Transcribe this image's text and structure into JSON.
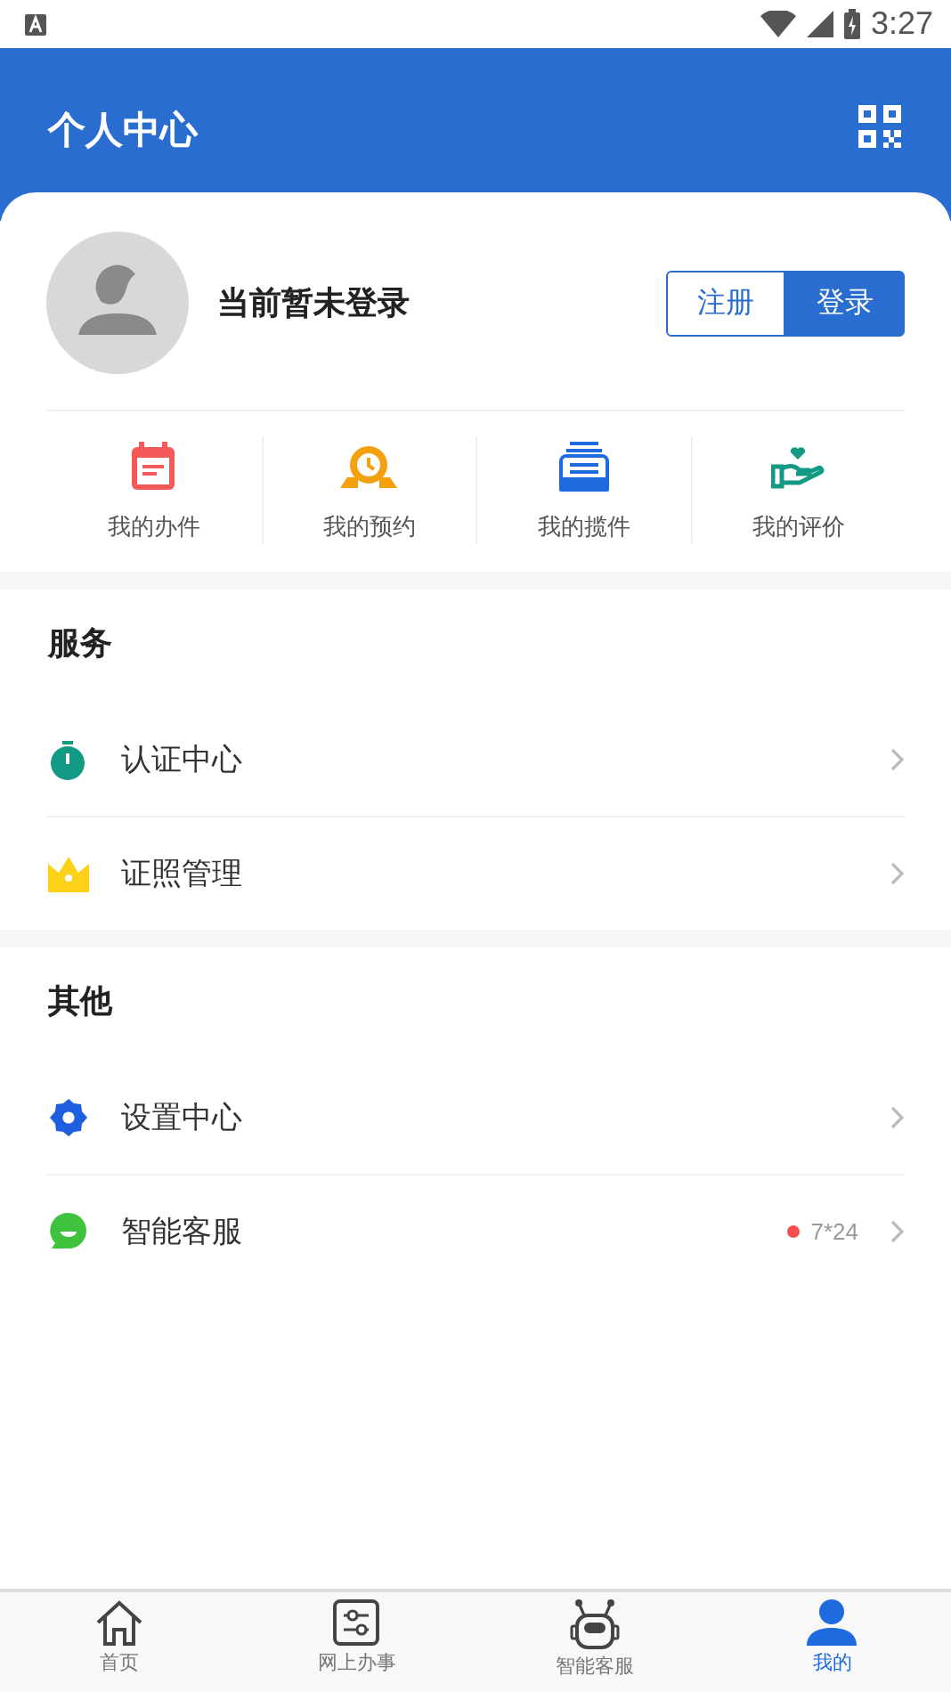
{
  "status_bar": {
    "time": "3:27"
  },
  "header": {
    "title": "个人中心"
  },
  "profile": {
    "name": "当前暂未登录",
    "buttons": [
      {
        "label": "注册",
        "kind": "outline"
      },
      {
        "label": "登录",
        "kind": "filled"
      }
    ]
  },
  "shortcuts": [
    {
      "label": "我的办件",
      "kind": "calendar"
    },
    {
      "label": "我的预约",
      "kind": "clock"
    },
    {
      "label": "我的揽件",
      "kind": "box"
    },
    {
      "label": "我的评价",
      "kind": "heart"
    }
  ],
  "sections": [
    {
      "title": "服务",
      "items": [
        {
          "label": "认证中心",
          "kind": "timer"
        },
        {
          "label": "证照管理",
          "kind": "crown"
        }
      ]
    },
    {
      "title": "其他",
      "items": [
        {
          "label": "设置中心",
          "kind": "gear"
        },
        {
          "label": "智能客服",
          "kind": "chat",
          "badge": "7*24",
          "color": "#f5504f"
        }
      ]
    }
  ],
  "tabbar": [
    {
      "label": "首页",
      "kind": "home",
      "selected": false
    },
    {
      "label": "网上办事",
      "kind": "sliders",
      "selected": false
    },
    {
      "label": "智能客服",
      "kind": "robot",
      "selected": false
    },
    {
      "label": "我的",
      "kind": "person",
      "selected": true
    }
  ]
}
